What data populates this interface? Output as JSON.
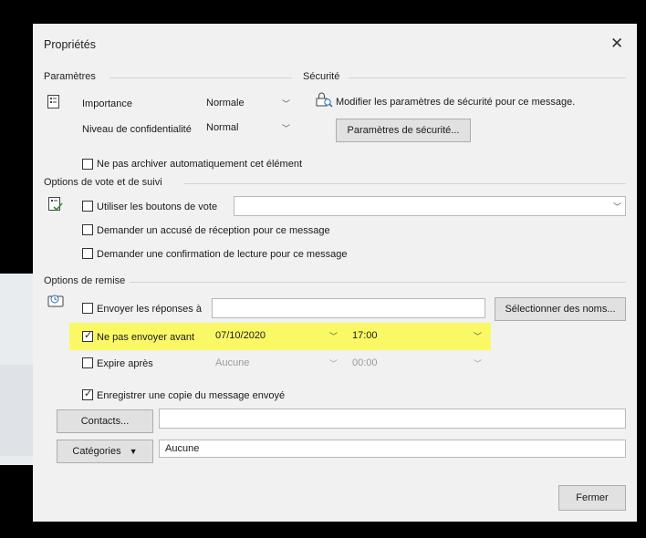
{
  "dialog": {
    "title": "Propriétés",
    "close_glyph": "✕"
  },
  "settings": {
    "group_label": "Paramètres",
    "importance_label": "Importance",
    "importance_value": "Normale",
    "sensitivity_label": "Niveau de confidentialité",
    "sensitivity_value": "Normal",
    "no_autoarchive_label": "Ne pas archiver automatiquement cet élément",
    "no_autoarchive_checked": false
  },
  "security": {
    "group_label": "Sécurité",
    "description": "Modifier les paramètres de sécurité pour ce message.",
    "button_label": "Paramètres de sécurité..."
  },
  "voting": {
    "group_label": "Options de vote et de suivi",
    "use_vote_label": "Utiliser les boutons de vote",
    "use_vote_checked": false,
    "vote_value": "",
    "delivery_receipt_label": "Demander un accusé de réception pour ce message",
    "delivery_receipt_checked": false,
    "read_receipt_label": "Demander une confirmation de lecture pour ce message",
    "read_receipt_checked": false
  },
  "delivery": {
    "group_label": "Options de remise",
    "send_replies_label": "Envoyer les réponses à",
    "send_replies_checked": false,
    "send_replies_value": "",
    "select_names_label": "Sélectionner des noms...",
    "do_not_deliver_label": "Ne pas envoyer avant",
    "do_not_deliver_checked": true,
    "do_not_deliver_date": "07/10/2020",
    "do_not_deliver_time": "17:00",
    "expires_label": "Expire après",
    "expires_checked": false,
    "expires_date": "Aucune",
    "expires_time": "00:00",
    "save_copy_label": "Enregistrer une copie du message envoyé",
    "save_copy_checked": true
  },
  "contacts": {
    "button_label": "Contacts...",
    "value": ""
  },
  "categories": {
    "button_label": "Catégories",
    "value": "Aucune"
  },
  "footer": {
    "close_label": "Fermer"
  },
  "colors": {
    "highlight": "#fbf866",
    "dialog_bg": "#f1f1f1"
  }
}
